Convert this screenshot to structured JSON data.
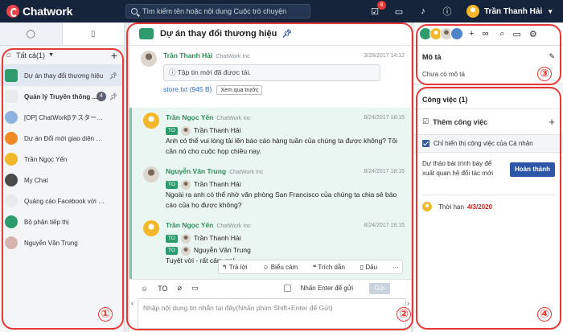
{
  "app": {
    "name": "Chatwork"
  },
  "header": {
    "search_placeholder": "Tìm kiếm tên hoặc nội dung Cuộc trò chuyện",
    "tasks_badge": "8",
    "user_name": "Trần Thanh Hải",
    "icons": [
      "check-icon",
      "folder-icon",
      "bell-icon",
      "info-icon"
    ]
  },
  "sidebar": {
    "filter_label": "Tất cả(1)",
    "rooms": [
      {
        "name": "Dự án thay đổi thương hiệu",
        "active": true,
        "pinned": true,
        "icon_color": "#2e9b6d"
      },
      {
        "name": "Quản lý Truyền thông ...",
        "bold": true,
        "count": "4",
        "pinned": true,
        "icon_color": "#e9ecef"
      },
      {
        "name": "[OP] ChatWorkβテスターの...",
        "icon_color": "#8fb3e0"
      },
      {
        "name": "Dự án Đổi mới giao diện ng...",
        "icon_color": "#f08a24"
      },
      {
        "name": "Trần Ngọc Yến",
        "icon_color": "#f3b72b"
      },
      {
        "name": "My Chat",
        "icon_color": "#4a4a4a"
      },
      {
        "name": "Quảng cáo Facebook với S...",
        "icon_color": "#e9ecef"
      },
      {
        "name": "Bộ phận tiếp thị",
        "icon_color": "#2e9b6d"
      },
      {
        "name": "Nguyễn Văn Trung",
        "icon_color": "#d8b4b0"
      }
    ]
  },
  "room": {
    "title": "Dự án thay đổi thương hiệu",
    "messages": [
      {
        "sender": "Trần Thanh Hải",
        "org": "ChatWork Inc",
        "time": "3/28/2017 14:12",
        "file_notice": "ⓘ Tập tin mới đã được tải.",
        "file_name": "store.txt (945 B)",
        "preview_label": "Xem qua trước"
      },
      {
        "sender": "Trần Ngọc Yến",
        "org": "ChatWork Inc",
        "time": "8/24/2017 18:15",
        "to_label": "TO",
        "to_name": "Trần Thanh Hải",
        "body": "Anh có thể vui lòng tải lên báo cáo hàng tuần của chúng ta được không? Tôi cần nó cho cuộc họp chiều nay."
      },
      {
        "sender": "Nguyễn Văn Trung",
        "org": "ChatWork Inc",
        "time": "8/24/2017 18:15",
        "to_label": "TO",
        "to_name": "Trần Thanh Hải",
        "body": "Ngoài ra anh có thể nhờ văn phòng San Francisco của chúng ta chia sẻ báo cáo của họ được không?"
      },
      {
        "sender": "Trần Ngọc Yến",
        "org": "ChatWork Inc",
        "time": "8/24/2017 18:15",
        "to_label": "TO",
        "to_name": "Trần Thanh Hải",
        "to_label2": "TO",
        "to_name2": "Nguyễn Văn Trung",
        "body": "Tuyệt vời - rất cảm ơn!"
      }
    ],
    "actions": {
      "reply": "Trả lời",
      "react": "Biểu cảm",
      "quote": "Trích dẫn",
      "mark": "Dấu",
      "more": "···"
    },
    "composer": {
      "to_label": "TO",
      "enter_label": "Nhấn Enter để gửi",
      "send_label": "Gửi",
      "placeholder": "Nhập nội dung tin nhắn tại đây(Nhấn phím Shift+Enter để Gửi)"
    }
  },
  "right": {
    "description_title": "Mô tả",
    "description_text": "Chưa có mô tả",
    "tasks_title": "Công việc (1)",
    "add_task": "Thêm công việc",
    "only_mine": "Chỉ hiển thị công việc của Cá nhân",
    "task_text": "Dự thảo bài trình bày để xuất quan hệ đối tác mới",
    "done_label": "Hoàn thành",
    "deadline_label": "Thời hạn",
    "deadline_date": "4/3/2020"
  },
  "annotations": [
    "①",
    "②",
    "③",
    "④"
  ],
  "colors": {
    "topbar": "#16243b",
    "accent_green": "#2e9b6d",
    "callout_red": "#e53935",
    "primary_blue": "#2d56a8"
  }
}
